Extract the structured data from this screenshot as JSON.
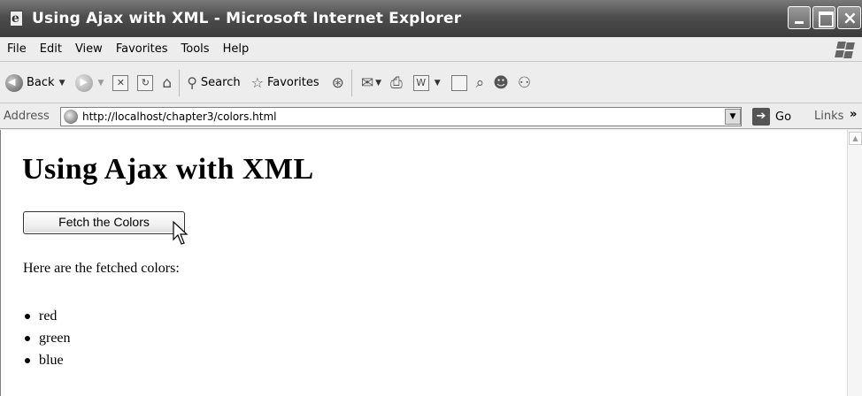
{
  "window": {
    "title": "Using Ajax with XML - Microsoft Internet Explorer"
  },
  "menubar": {
    "items": [
      "File",
      "Edit",
      "View",
      "Favorites",
      "Tools",
      "Help"
    ]
  },
  "toolbar": {
    "back_label": "Back",
    "search_label": "Search",
    "favorites_label": "Favorites"
  },
  "addressbar": {
    "label": "Address",
    "url": "http://localhost/chapter3/colors.html",
    "go_label": "Go",
    "links_label": "Links"
  },
  "page": {
    "heading": "Using Ajax with XML",
    "button_label": "Fetch the Colors",
    "intro": "Here are the fetched colors:",
    "colors": [
      "red",
      "green",
      "blue"
    ]
  }
}
